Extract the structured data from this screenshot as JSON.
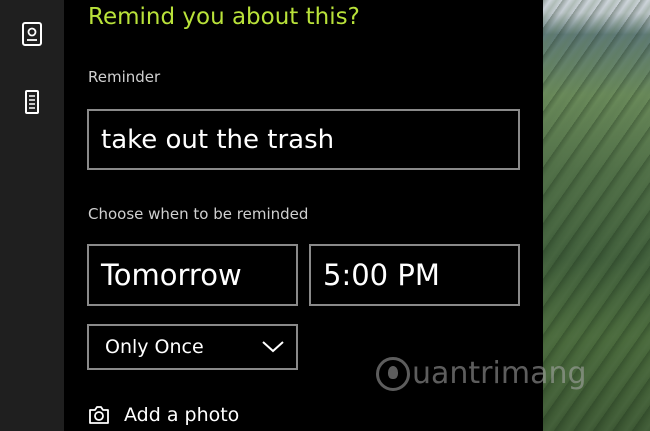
{
  "sidebar": {
    "items": [
      {
        "icon": "notebook-icon"
      },
      {
        "icon": "device-icon"
      }
    ]
  },
  "dialog": {
    "title": "Remind you about this?",
    "reminder_label": "Reminder",
    "reminder_value": "take out the trash",
    "when_label": "Choose when to be reminded",
    "date_value": "Tomorrow",
    "time_value": "5:00 PM",
    "repeat_value": "Only Once",
    "add_photo_label": "Add a photo"
  },
  "watermark": {
    "text": "uantrimang"
  },
  "colors": {
    "title_accent": "#b9e23a",
    "panel_bg": "#000000",
    "rail_bg": "#1f1f1f",
    "field_border": "#8a8a8a"
  }
}
